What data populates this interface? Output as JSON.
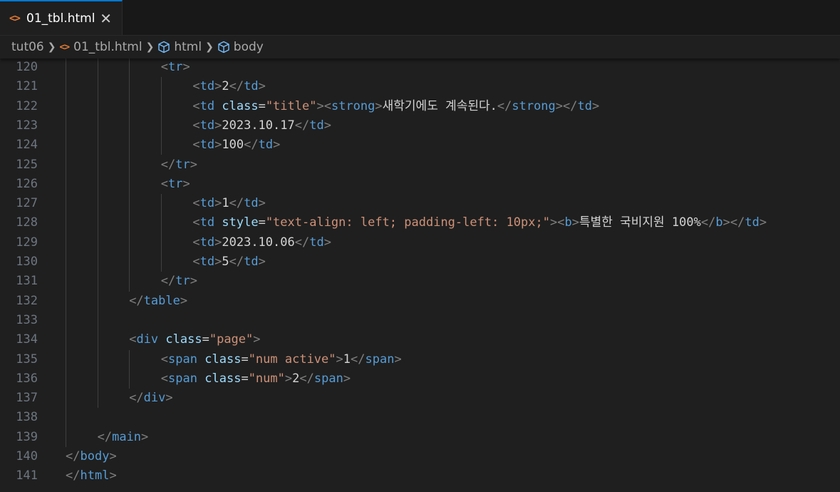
{
  "tab": {
    "icon": "html-code-icon",
    "label": "01_tbl.html",
    "close": "✕"
  },
  "breadcrumb": {
    "folder": "tut06",
    "file": "01_tbl.html",
    "html": "html",
    "body": "body"
  },
  "colors": {
    "tag": "#569cd6",
    "attr": "#9cdcfe",
    "string": "#ce9178",
    "bracket": "#808080",
    "text": "#d4d4d4",
    "line_number": "#6e7681",
    "accent": "#0078d4",
    "html_icon": "#e37933"
  },
  "editor": {
    "lines": [
      {
        "n": "120",
        "indent": 6,
        "tokens": [
          [
            "br",
            "<"
          ],
          [
            "tag",
            "tr"
          ],
          [
            "br",
            ">"
          ]
        ]
      },
      {
        "n": "121",
        "indent": 8,
        "tokens": [
          [
            "br",
            "<"
          ],
          [
            "tag",
            "td"
          ],
          [
            "br",
            ">"
          ],
          [
            "txt",
            "2"
          ],
          [
            "br",
            "</"
          ],
          [
            "tag",
            "td"
          ],
          [
            "br",
            ">"
          ]
        ]
      },
      {
        "n": "122",
        "indent": 8,
        "tokens": [
          [
            "br",
            "<"
          ],
          [
            "tag",
            "td"
          ],
          [
            "txt",
            " "
          ],
          [
            "attr",
            "class"
          ],
          [
            "eq",
            "="
          ],
          [
            "str",
            "\"title\""
          ],
          [
            "br",
            ">"
          ],
          [
            "br",
            "<"
          ],
          [
            "tag",
            "strong"
          ],
          [
            "br",
            ">"
          ],
          [
            "txt",
            "새학기에도 계속된다."
          ],
          [
            "br",
            "</"
          ],
          [
            "tag",
            "strong"
          ],
          [
            "br",
            ">"
          ],
          [
            "br",
            "</"
          ],
          [
            "tag",
            "td"
          ],
          [
            "br",
            ">"
          ]
        ]
      },
      {
        "n": "123",
        "indent": 8,
        "tokens": [
          [
            "br",
            "<"
          ],
          [
            "tag",
            "td"
          ],
          [
            "br",
            ">"
          ],
          [
            "txt",
            "2023.10.17"
          ],
          [
            "br",
            "</"
          ],
          [
            "tag",
            "td"
          ],
          [
            "br",
            ">"
          ]
        ]
      },
      {
        "n": "124",
        "indent": 8,
        "tokens": [
          [
            "br",
            "<"
          ],
          [
            "tag",
            "td"
          ],
          [
            "br",
            ">"
          ],
          [
            "txt",
            "100"
          ],
          [
            "br",
            "</"
          ],
          [
            "tag",
            "td"
          ],
          [
            "br",
            ">"
          ]
        ]
      },
      {
        "n": "125",
        "indent": 6,
        "tokens": [
          [
            "br",
            "</"
          ],
          [
            "tag",
            "tr"
          ],
          [
            "br",
            ">"
          ]
        ]
      },
      {
        "n": "126",
        "indent": 6,
        "tokens": [
          [
            "br",
            "<"
          ],
          [
            "tag",
            "tr"
          ],
          [
            "br",
            ">"
          ]
        ]
      },
      {
        "n": "127",
        "indent": 8,
        "tokens": [
          [
            "br",
            "<"
          ],
          [
            "tag",
            "td"
          ],
          [
            "br",
            ">"
          ],
          [
            "txt",
            "1"
          ],
          [
            "br",
            "</"
          ],
          [
            "tag",
            "td"
          ],
          [
            "br",
            ">"
          ]
        ]
      },
      {
        "n": "128",
        "indent": 8,
        "tokens": [
          [
            "br",
            "<"
          ],
          [
            "tag",
            "td"
          ],
          [
            "txt",
            " "
          ],
          [
            "attr",
            "style"
          ],
          [
            "eq",
            "="
          ],
          [
            "str",
            "\"text-align: left; padding-left: 10px;\""
          ],
          [
            "br",
            ">"
          ],
          [
            "br",
            "<"
          ],
          [
            "tag",
            "b"
          ],
          [
            "br",
            ">"
          ],
          [
            "txt",
            "특별한 국비지원 100%"
          ],
          [
            "br",
            "</"
          ],
          [
            "tag",
            "b"
          ],
          [
            "br",
            ">"
          ],
          [
            "br",
            "</"
          ],
          [
            "tag",
            "td"
          ],
          [
            "br",
            ">"
          ]
        ]
      },
      {
        "n": "129",
        "indent": 8,
        "tokens": [
          [
            "br",
            "<"
          ],
          [
            "tag",
            "td"
          ],
          [
            "br",
            ">"
          ],
          [
            "txt",
            "2023.10.06"
          ],
          [
            "br",
            "</"
          ],
          [
            "tag",
            "td"
          ],
          [
            "br",
            ">"
          ]
        ]
      },
      {
        "n": "130",
        "indent": 8,
        "tokens": [
          [
            "br",
            "<"
          ],
          [
            "tag",
            "td"
          ],
          [
            "br",
            ">"
          ],
          [
            "txt",
            "5"
          ],
          [
            "br",
            "</"
          ],
          [
            "tag",
            "td"
          ],
          [
            "br",
            ">"
          ]
        ]
      },
      {
        "n": "131",
        "indent": 6,
        "tokens": [
          [
            "br",
            "</"
          ],
          [
            "tag",
            "tr"
          ],
          [
            "br",
            ">"
          ]
        ]
      },
      {
        "n": "132",
        "indent": 4,
        "tokens": [
          [
            "br",
            "</"
          ],
          [
            "tag",
            "table"
          ],
          [
            "br",
            ">"
          ]
        ]
      },
      {
        "n": "133",
        "indent": 0,
        "tokens": []
      },
      {
        "n": "134",
        "indent": 4,
        "tokens": [
          [
            "br",
            "<"
          ],
          [
            "tag",
            "div"
          ],
          [
            "txt",
            " "
          ],
          [
            "attr",
            "class"
          ],
          [
            "eq",
            "="
          ],
          [
            "str",
            "\"page\""
          ],
          [
            "br",
            ">"
          ]
        ]
      },
      {
        "n": "135",
        "indent": 6,
        "tokens": [
          [
            "br",
            "<"
          ],
          [
            "tag",
            "span"
          ],
          [
            "txt",
            " "
          ],
          [
            "attr",
            "class"
          ],
          [
            "eq",
            "="
          ],
          [
            "str",
            "\"num active\""
          ],
          [
            "br",
            ">"
          ],
          [
            "txt",
            "1"
          ],
          [
            "br",
            "</"
          ],
          [
            "tag",
            "span"
          ],
          [
            "br",
            ">"
          ]
        ]
      },
      {
        "n": "136",
        "indent": 6,
        "tokens": [
          [
            "br",
            "<"
          ],
          [
            "tag",
            "span"
          ],
          [
            "txt",
            " "
          ],
          [
            "attr",
            "class"
          ],
          [
            "eq",
            "="
          ],
          [
            "str",
            "\"num\""
          ],
          [
            "br",
            ">"
          ],
          [
            "txt",
            "2"
          ],
          [
            "br",
            "</"
          ],
          [
            "tag",
            "span"
          ],
          [
            "br",
            ">"
          ]
        ]
      },
      {
        "n": "137",
        "indent": 4,
        "tokens": [
          [
            "br",
            "</"
          ],
          [
            "tag",
            "div"
          ],
          [
            "br",
            ">"
          ]
        ]
      },
      {
        "n": "138",
        "indent": 0,
        "tokens": []
      },
      {
        "n": "139",
        "indent": 2,
        "tokens": [
          [
            "br",
            "</"
          ],
          [
            "tag",
            "main"
          ],
          [
            "br",
            ">"
          ]
        ]
      },
      {
        "n": "140",
        "indent": 0,
        "tokens": [
          [
            "br",
            "</"
          ],
          [
            "tag",
            "body"
          ],
          [
            "br",
            ">"
          ]
        ]
      },
      {
        "n": "141",
        "indent": 0,
        "tokens": [
          [
            "br",
            "</"
          ],
          [
            "tag",
            "html"
          ],
          [
            "br",
            ">"
          ]
        ]
      }
    ]
  }
}
